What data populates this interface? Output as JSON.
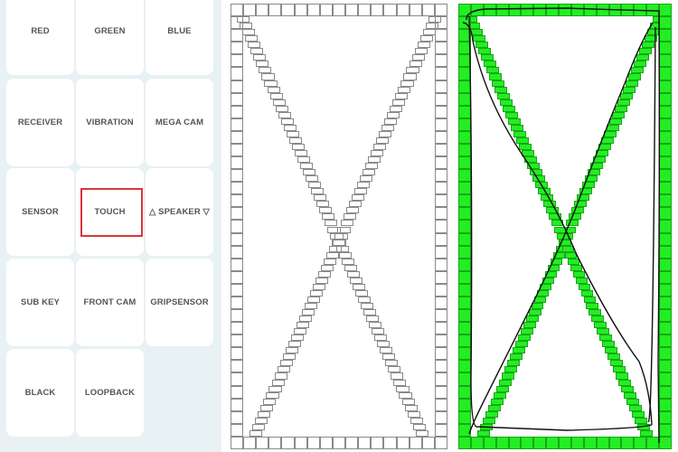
{
  "menu": {
    "buttons": [
      "RED",
      "GREEN",
      "BLUE",
      "RECEIVER",
      "VIBRATION",
      "MEGA CAM",
      "SENSOR",
      "TOUCH",
      "△ SPEAKER ▽",
      "SUB KEY",
      "FRONT CAM",
      "GRIPSENSOR",
      "BLACK",
      "LOOPBACK"
    ],
    "highlighted": "TOUCH",
    "highlight_color": "#d9363e"
  },
  "touch_test": {
    "untested_color": "#ffffff",
    "passed_color": "#22ee22",
    "before_state": "untested",
    "after_state": "passed"
  }
}
